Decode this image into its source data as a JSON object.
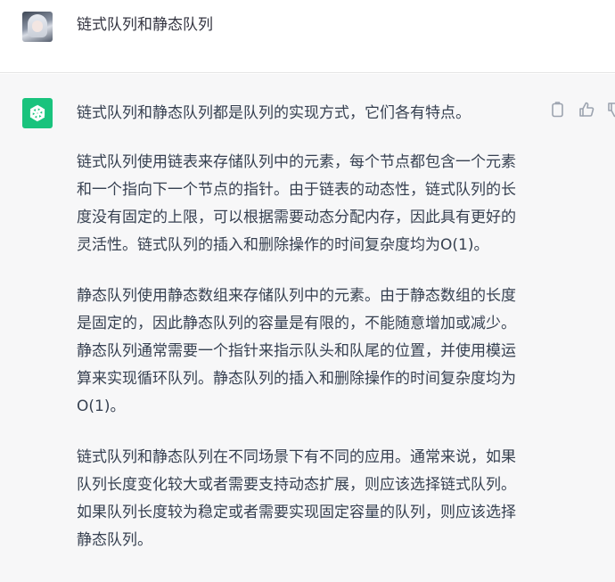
{
  "user": {
    "avatar_icon": "user-avatar-anime",
    "message": "链式队列和静态队列"
  },
  "assistant": {
    "avatar_icon": "openai-logo-icon",
    "accent_color": "#19c37d",
    "paragraphs": [
      "链式队列和静态队列都是队列的实现方式，它们各有特点。",
      "链式队列使用链表来存储队列中的元素，每个节点都包含一个元素和一个指向下一个节点的指针。由于链表的动态性，链式队列的长度没有固定的上限，可以根据需要动态分配内存，因此具有更好的灵活性。链式队列的插入和删除操作的时间复杂度均为O(1)。",
      "静态队列使用静态数组来存储队列中的元素。由于静态数组的长度是固定的，因此静态队列的容量是有限的，不能随意增加或减少。静态队列通常需要一个指针来指示队头和队尾的位置，并使用模运算来实现循环队列。静态队列的插入和删除操作的时间复杂度均为O(1)。",
      "链式队列和静态队列在不同场景下有不同的应用。通常来说，如果队列长度变化较大或者需要支持动态扩展，则应该选择链式队列。如果队列长度较为稳定或者需要实现固定容量的队列，则应该选择静态队列。"
    ],
    "actions": [
      "copy-icon",
      "thumbs-up-icon",
      "thumbs-down-icon"
    ]
  }
}
